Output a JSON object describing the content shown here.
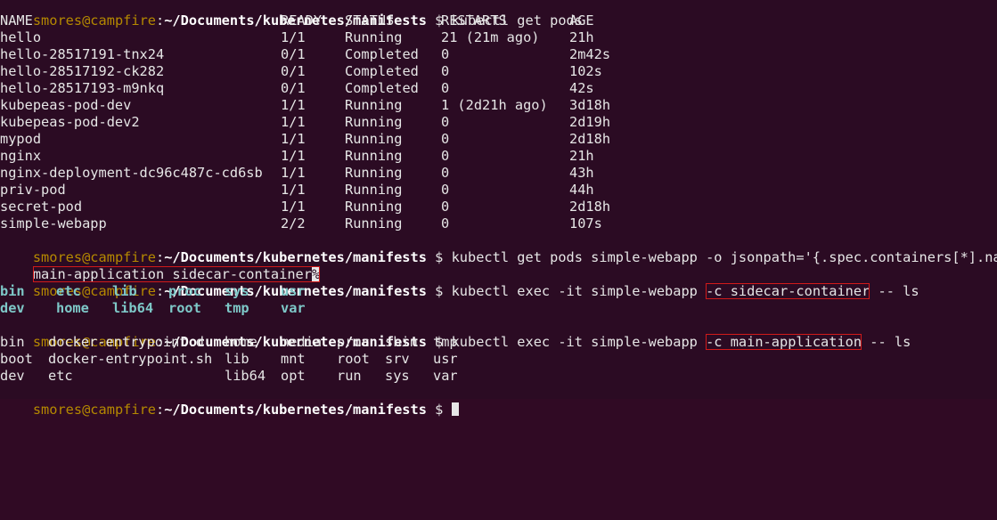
{
  "prompt": {
    "user_host": "smores@campfire",
    "path": "~/Documents/kubernetes/manifests",
    "symbol": "$"
  },
  "commands": {
    "get_pods": "kubectl get pods",
    "get_containers": "kubectl get pods simple-webapp -o jsonpath='{.spec.containers[*].name}'",
    "exec_sidecar_prefix": "kubectl exec -it simple-webapp ",
    "exec_sidecar_flag": "-c sidecar-container",
    "exec_sidecar_suffix": " -- ls",
    "exec_main_prefix": "kubectl exec -it simple-webapp ",
    "exec_main_flag": "-c main-application",
    "exec_main_suffix": " -- ls"
  },
  "pods_table": {
    "headers": [
      "NAME",
      "READY",
      "STATUS",
      "RESTARTS",
      "AGE"
    ],
    "rows": [
      [
        "hello",
        "1/1",
        "Running",
        "21 (21m ago)",
        "21h"
      ],
      [
        "hello-28517191-tnx24",
        "0/1",
        "Completed",
        "0",
        "2m42s"
      ],
      [
        "hello-28517192-ck282",
        "0/1",
        "Completed",
        "0",
        "102s"
      ],
      [
        "hello-28517193-m9nkq",
        "0/1",
        "Completed",
        "0",
        "42s"
      ],
      [
        "kubepeas-pod-dev",
        "1/1",
        "Running",
        "1 (2d21h ago)",
        "3d18h"
      ],
      [
        "kubepeas-pod-dev2",
        "1/1",
        "Running",
        "0",
        "2d19h"
      ],
      [
        "mypod",
        "1/1",
        "Running",
        "0",
        "2d18h"
      ],
      [
        "nginx",
        "1/1",
        "Running",
        "0",
        "21h"
      ],
      [
        "nginx-deployment-dc96c487c-cd6sb",
        "1/1",
        "Running",
        "0",
        "43h"
      ],
      [
        "priv-pod",
        "1/1",
        "Running",
        "0",
        "44h"
      ],
      [
        "secret-pod",
        "1/1",
        "Running",
        "0",
        "2d18h"
      ],
      [
        "simple-webapp",
        "2/2",
        "Running",
        "0",
        "107s"
      ]
    ]
  },
  "containers_output": "main-application sidecar-container",
  "containers_output_cursor": "%",
  "sidecar_ls": {
    "row1": [
      "bin",
      "etc",
      "lib",
      "proc",
      "sys",
      "usr"
    ],
    "row2": [
      "dev",
      "home",
      "lib64",
      "root",
      "tmp",
      "var"
    ]
  },
  "main_ls": {
    "row1": [
      "bin",
      "docker-entrypoint.d",
      "home",
      "media",
      "proc",
      "sbin",
      "tmp"
    ],
    "row2": [
      "boot",
      "docker-entrypoint.sh",
      "lib",
      "mnt",
      "root",
      "srv",
      "usr"
    ],
    "row3": [
      "dev",
      "etc",
      "",
      "lib64",
      "opt",
      "run",
      "sys",
      "var"
    ]
  },
  "colors": {
    "background": "#2b0b23",
    "prompt_user": "#b58900",
    "prompt_path": "#ffffff",
    "dir_listing": "#7ec8c8",
    "highlight_box": "#d11a1a"
  }
}
